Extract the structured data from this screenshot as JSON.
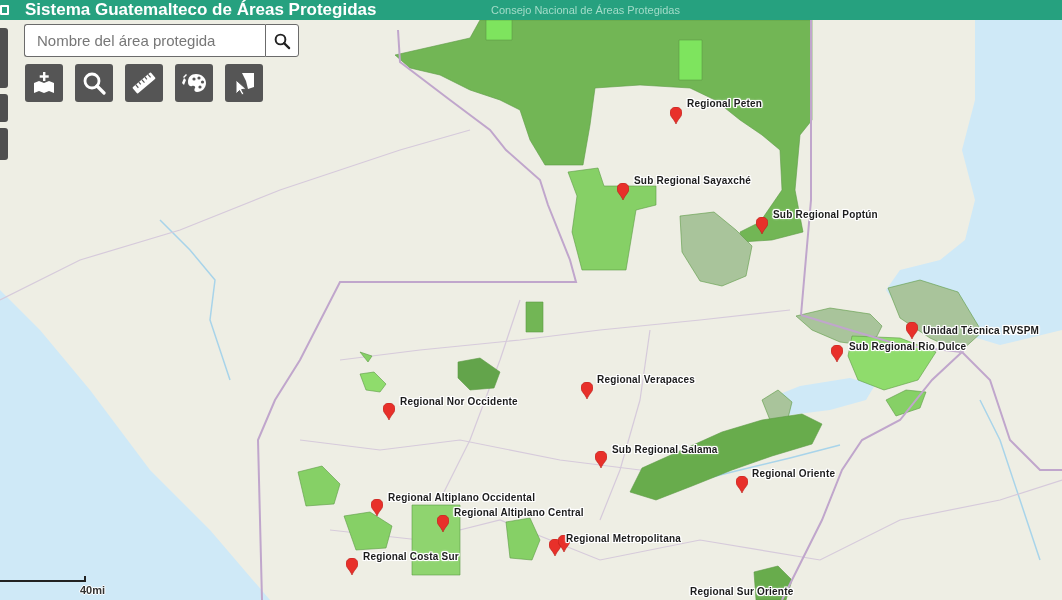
{
  "header": {
    "title": "Sistema Guatemalteco de Áreas Protegidas",
    "subtitle": "Consejo Nacional de Áreas Protegidas"
  },
  "search": {
    "placeholder": "Nombre del área protegida"
  },
  "map": {
    "offices": [
      "Regional Peten",
      "Sub Regional Sayaxché",
      "Sub Regional Poptún",
      "Unidad Técnica RVSPM",
      "Sub Regional Rio Dulce",
      "Regional Verapaces",
      "Regional Nor Occidente",
      "Sub Regional Salama",
      "Regional Oriente",
      "Regional Altiplano Occidental",
      "Regional Altiplano Central",
      "Regional Metropolitana",
      "Regional Costa Sur",
      "Regional Sur Oriente"
    ],
    "scale_bar": {
      "label": "40mi"
    }
  }
}
